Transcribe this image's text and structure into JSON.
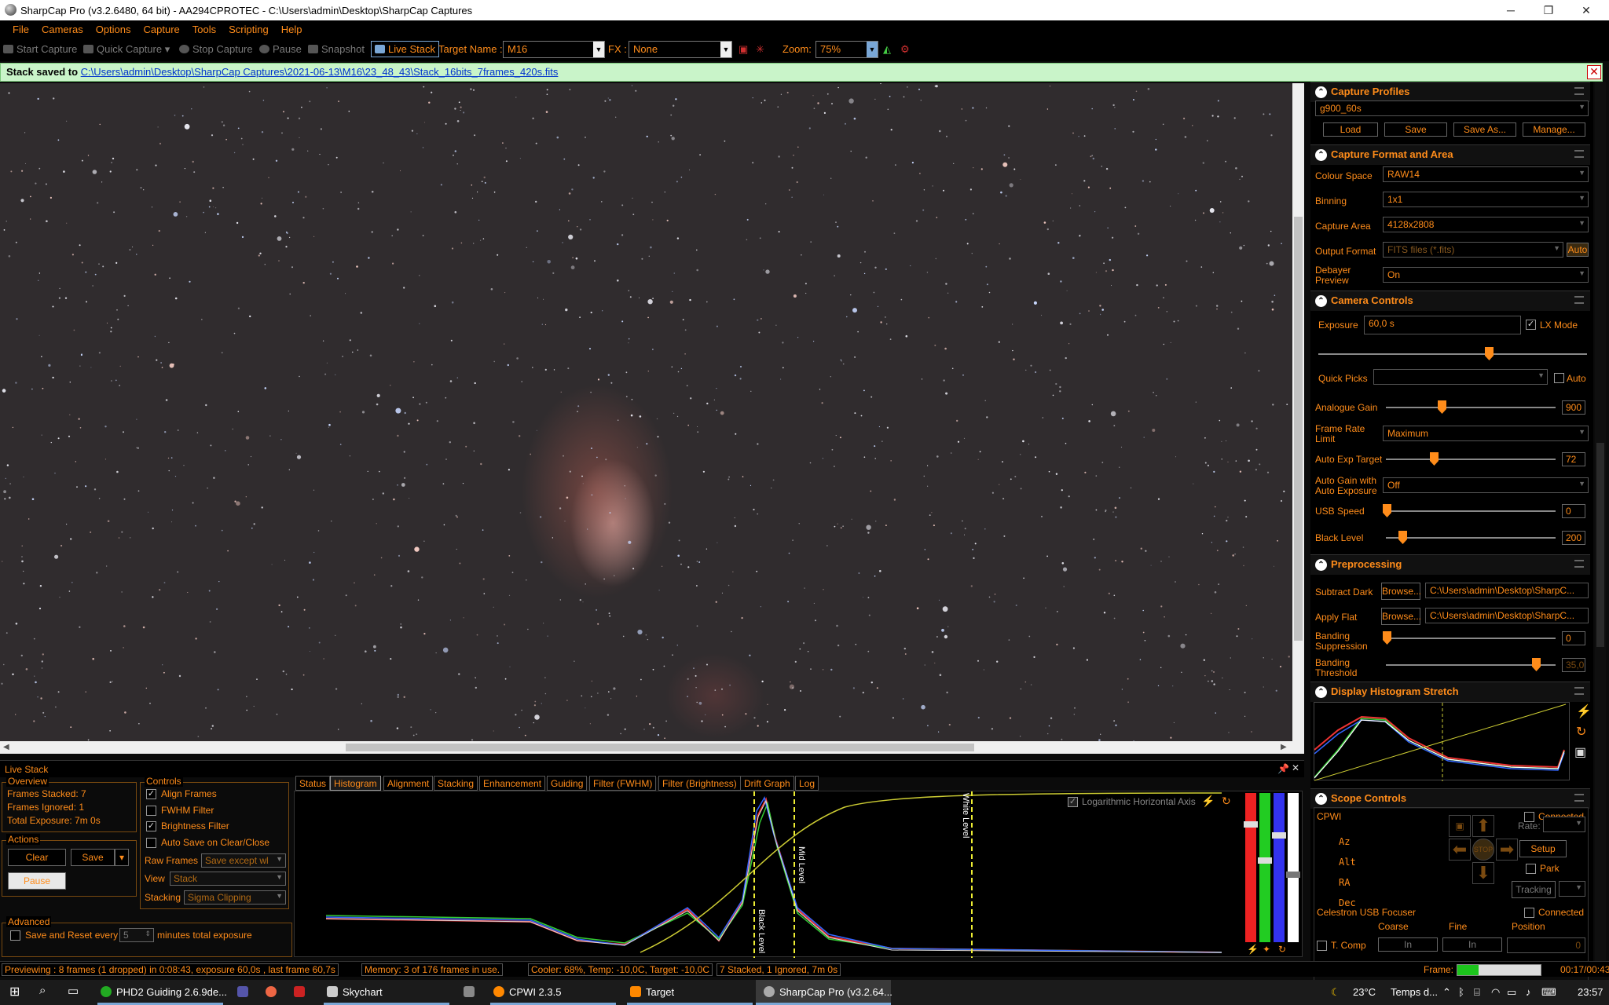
{
  "window": {
    "title": "SharpCap Pro (v3.2.6480, 64 bit) - AA294CPROTEC - C:\\Users\\admin\\Desktop\\SharpCap Captures",
    "minimize": "─",
    "maximize": "❐",
    "close": "✕"
  },
  "menu": [
    "File",
    "Cameras",
    "Options",
    "Capture",
    "Tools",
    "Scripting",
    "Help"
  ],
  "toolbar": {
    "start_capture": "Start Capture",
    "quick_capture": "Quick Capture",
    "stop_capture": "Stop Capture",
    "pause": "Pause",
    "snapshot": "Snapshot",
    "live_stack": "Live Stack",
    "target_name_label": "Target Name :",
    "target_name": "M16",
    "fx_label": "FX :",
    "fx": "None",
    "zoom_label": "Zoom:",
    "zoom": "75%"
  },
  "banner": {
    "prefix": "Stack saved to ",
    "link": "C:\\Users\\admin\\Desktop\\SharpCap Captures\\2021-06-13\\M16\\23_48_43\\Stack_16bits_7frames_420s.fits",
    "close": "✕"
  },
  "right_panel": {
    "capture_profiles": {
      "title": "Capture Profiles",
      "profile": "g900_60s",
      "buttons": [
        "Load",
        "Save",
        "Save As...",
        "Manage..."
      ]
    },
    "format_area": {
      "title": "Capture Format and Area",
      "colour_space_label": "Colour Space",
      "colour_space": "RAW14",
      "binning_label": "Binning",
      "binning": "1x1",
      "capture_area_label": "Capture Area",
      "capture_area": "4128x2808",
      "output_format_label": "Output Format",
      "output_format": "FITS files (*.fits)",
      "auto": "Auto",
      "debayer_label": "Debayer Preview",
      "debayer": "On"
    },
    "camera_controls": {
      "title": "Camera Controls",
      "exposure_label": "Exposure",
      "exposure": "60,0 s",
      "lx_mode": "LX Mode",
      "quick_picks_label": "Quick Picks",
      "auto_label": "Auto",
      "analogue_gain_label": "Analogue Gain",
      "analogue_gain": "900",
      "frame_rate_label": "Frame Rate Limit",
      "frame_rate": "Maximum",
      "auto_exp_label": "Auto Exp Target",
      "auto_exp": "72",
      "auto_gain_label": "Auto Gain with Auto Exposure",
      "auto_gain": "Off",
      "usb_label": "USB Speed",
      "usb": "0",
      "black_label": "Black Level",
      "black": "200"
    },
    "preprocessing": {
      "title": "Preprocessing",
      "dark_label": "Subtract Dark",
      "browse": "Browse...",
      "dark": "C:\\Users\\admin\\Desktop\\SharpC...",
      "flat_label": "Apply Flat",
      "flat": "C:\\Users\\admin\\Desktop\\SharpC...",
      "banding_sup_label": "Banding Suppression",
      "banding_sup": "0",
      "banding_thr_label": "Banding Threshold",
      "banding_thr": "35,0"
    },
    "histogram_stretch": {
      "title": "Display Histogram Stretch"
    },
    "scope": {
      "title": "Scope Controls",
      "mount": "CPWI",
      "connected": "Connected",
      "az": "Az",
      "alt": "Alt",
      "ra": "RA",
      "dec": "Dec",
      "rate_label": "Rate:",
      "stop": "STOP",
      "setup": "Setup",
      "park": "Park",
      "tracking": "Tracking"
    },
    "focuser": {
      "name": "Celestron USB Focuser",
      "connected": "Connected",
      "coarse": "Coarse",
      "fine": "Fine",
      "position": "Position",
      "tcomp": "T. Comp",
      "in1": "In",
      "in2": "In",
      "pos_val": "0"
    }
  },
  "live_stack": {
    "title": "Live Stack",
    "overview": {
      "title": "Overview",
      "stacked": "Frames Stacked:  7",
      "ignored": "Frames Ignored:  1",
      "total": "Total Exposure:   7m 0s"
    },
    "actions": {
      "title": "Actions",
      "clear": "Clear",
      "save": "Save",
      "pause": "Pause"
    },
    "controls": {
      "title": "Controls",
      "align": "Align Frames",
      "fwhm": "FWHM Filter",
      "brightness": "Brightness Filter",
      "autosave": "Auto Save on Clear/Close",
      "raw_label": "Raw Frames",
      "raw": "Save except wl",
      "view_label": "View",
      "view": "Stack",
      "stacking_label": "Stacking",
      "stacking": "Sigma Clipping"
    },
    "advanced": {
      "title": "Advanced",
      "save_reset": "Save and Reset every",
      "minutes": "5",
      "suffix": "minutes total exposure"
    },
    "tabs": [
      "Status",
      "Histogram",
      "Alignment",
      "Stacking",
      "Enhancement",
      "Guiding",
      "Filter (FWHM)",
      "Filter (Brightness)",
      "Drift Graph",
      "Log"
    ],
    "log_axis": "Logarithmic Horizontal Axis",
    "black_level": "Black Level",
    "mid_level": "Mid Level",
    "white_level": "White Level"
  },
  "status": {
    "previewing": "Previewing : 8 frames (1 dropped) in 0:08:43, exposure 60,0s , last frame 60,7s",
    "memory": "Memory: 3 of 176 frames in use.",
    "cooler": "Cooler: 68%, Temp: -10,0C, Target: -10,0C",
    "stacked": "7 Stacked, 1 Ignored, 7m 0s",
    "frame_label": "Frame:",
    "frame_progress": 0.25,
    "time": "00:17/00:43"
  },
  "taskbar": {
    "items": [
      "PHD2 Guiding 2.6.9de...",
      "Skychart",
      "CPWI 2.3.5",
      "Target",
      "SharpCap Pro (v3.2.64..."
    ],
    "temp": "23°C",
    "weather": "Temps d...",
    "clock": "23:57"
  },
  "colors": {
    "accent": "#ff8c1a",
    "banner": "#c9f4c9"
  }
}
